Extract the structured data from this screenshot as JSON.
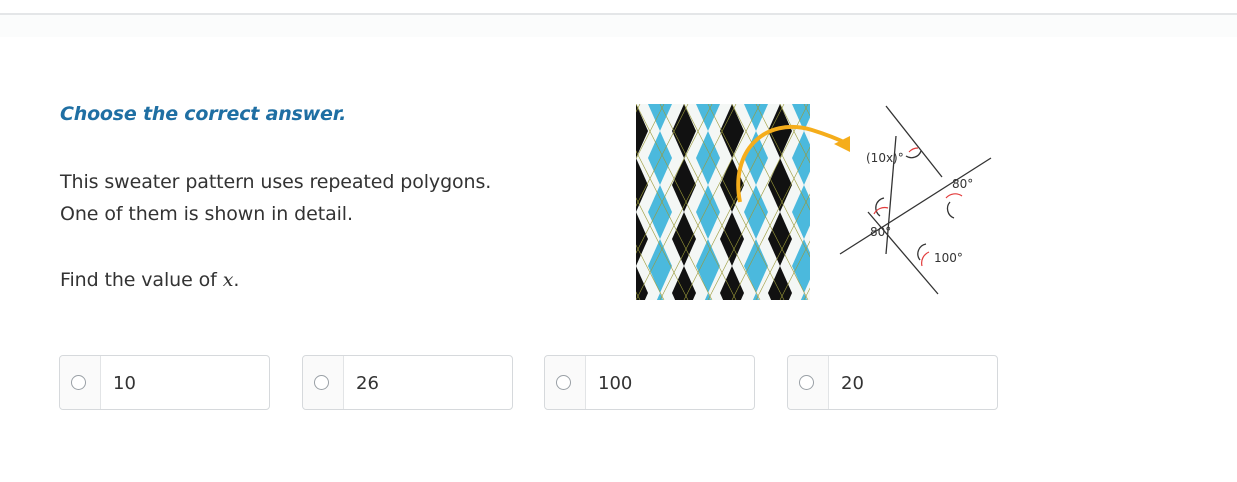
{
  "instruction": "Choose the correct answer.",
  "question": {
    "line1": "This sweater pattern uses repeated polygons.",
    "line2": "One of them is shown in detail.",
    "line3_prefix": "Find the value of ",
    "line3_variable": "x",
    "line3_suffix": "."
  },
  "figure": {
    "angle_top": "(10x)°",
    "angle_right": "80°",
    "angle_left": "80°",
    "angle_bottom": "100°",
    "colors": {
      "pattern_blue": "#4bb9dd",
      "pattern_black": "#111111",
      "pattern_white": "#f4f7f5",
      "arrow": "#f5ad1b",
      "angle_mark_red": "#e23b3b"
    }
  },
  "choices": [
    {
      "label": "10"
    },
    {
      "label": "26"
    },
    {
      "label": "100"
    },
    {
      "label": "20"
    }
  ]
}
